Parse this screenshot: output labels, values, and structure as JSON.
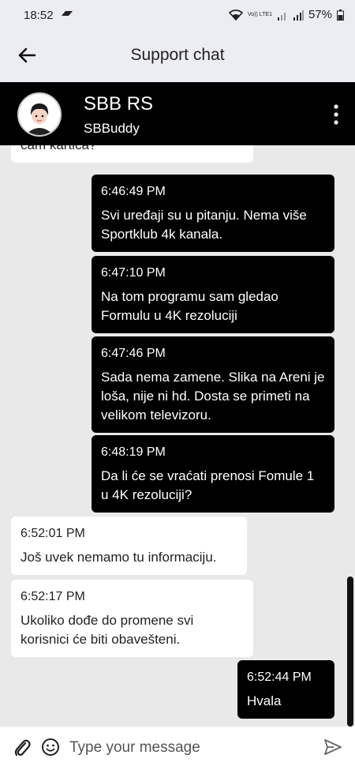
{
  "status_bar": {
    "time": "18:52",
    "volte": "Vo)) LTE1",
    "battery": "57%"
  },
  "header": {
    "title": "Support chat"
  },
  "chat": {
    "name": "SBB RS",
    "subtitle": "SBBuddy"
  },
  "messages": [
    {
      "direction": "in",
      "time": "",
      "text": "cam kartica?"
    },
    {
      "direction": "out",
      "time": "6:46:49 PM",
      "text": "Svi uređaji su u pitanju. Nema više Sportklub 4k kanala."
    },
    {
      "direction": "out",
      "time": "6:47:10 PM",
      "text": "Na tom programu sam gledao Formulu u 4K rezoluciji"
    },
    {
      "direction": "out",
      "time": "6:47:46 PM",
      "text": "Sada nema zamene. Slika na Areni je loša, nije ni hd. Dosta se primeti na velikom televizoru."
    },
    {
      "direction": "out",
      "time": "6:48:19 PM",
      "text": "Da li će se vraćati prenosi Fomule 1 u 4K rezoluciji?"
    },
    {
      "direction": "in",
      "time": "6:52:01 PM",
      "text": "Još uvek nemamo tu informaciju."
    },
    {
      "direction": "in",
      "time": "6:52:17 PM",
      "text": "Ukoliko dođe do promene svi korisnici će biti obavešteni."
    },
    {
      "direction": "out",
      "time": "6:52:44 PM",
      "text": "Hvala"
    }
  ],
  "composer": {
    "placeholder": "Type your message"
  }
}
